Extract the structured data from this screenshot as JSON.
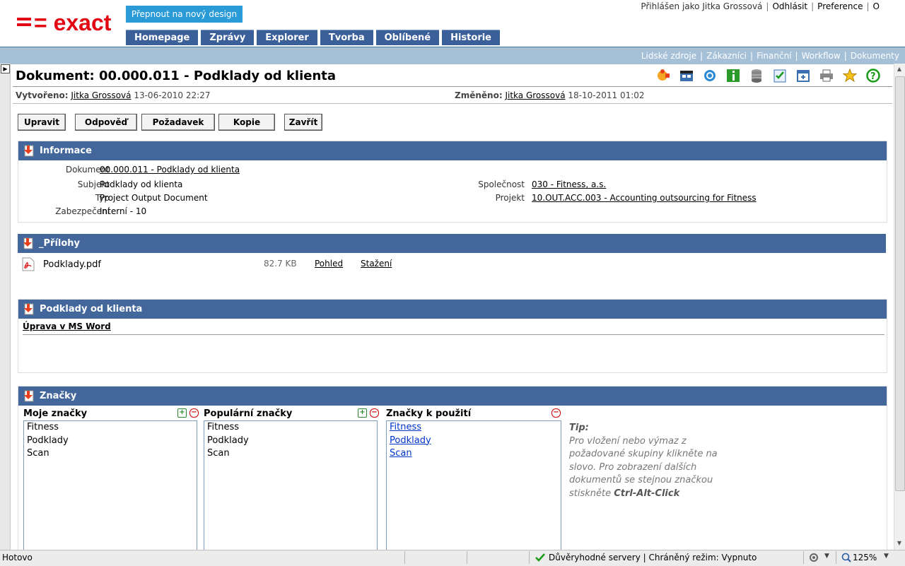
{
  "header": {
    "logo_text": "= exact",
    "new_design_button": "Přepnout na nový design",
    "nav": [
      "Homepage",
      "Zprávy",
      "Explorer",
      "Tvorba",
      "Oblíbené",
      "Historie"
    ],
    "user_links": [
      "Přihlášen jako Jitka Grossová",
      "Odhlásit",
      "Preference",
      "O"
    ],
    "sub_links": [
      "Lidské zdroje",
      "Zákazníci",
      "Finanční",
      "Workflow",
      "Dokumenty"
    ]
  },
  "document": {
    "title": "Dokument: 00.000.011 - Podklady od klienta",
    "created_label": "Vytvořeno:",
    "created_by": "Jitka Grossová",
    "created_at": "13-06-2010 22:27",
    "changed_label": "Změněno:",
    "changed_by": "Jitka Grossová",
    "changed_at": "18-10-2011 01:02"
  },
  "toolbar_icons": [
    "puzzle-icon",
    "clapboard-icon",
    "refresh-globe-icon",
    "info-icon",
    "database-icon",
    "checklist-icon",
    "add-window-icon",
    "print-icon",
    "favorite-star-icon",
    "help-icon"
  ],
  "actions": [
    "Upravit",
    "Odpověď",
    "Požadavek",
    "Kopie",
    "Zavřít"
  ],
  "info_panel": {
    "title": "Informace",
    "dokument_label": "Dokument",
    "dokument_value": "00.000.011 - Podklady od klienta",
    "subjekt_label": "Subjekt",
    "subjekt_value": "Podklady od klienta",
    "typ_label": "Typ",
    "typ_value": "Project Output Document",
    "zabezpeceni_label": "Zabezpečení",
    "zabezpeceni_value": "Interní - 10",
    "spolecnost_label": "Společnost",
    "spolecnost_value": "030 - Fitness, a.s.",
    "projekt_label": "Projekt",
    "projekt_value": "10.OUT.ACC.003 - Accounting outsourcing for Fitness"
  },
  "attachments_panel": {
    "title": "_Přílohy",
    "file_name": "Podklady.pdf",
    "file_size": "82.7 KB",
    "view_link": "Pohled",
    "download_link": "Stažení"
  },
  "content_panel": {
    "title": "Podklady od klienta",
    "edit_link": "Úprava v MS Word"
  },
  "tags_panel": {
    "title": "Značky",
    "my_tags_title": "Moje značky",
    "my_tags": [
      "Fitness",
      "Podklady",
      "Scan"
    ],
    "popular_tags_title": "Populární značky",
    "popular_tags": [
      "Fitness",
      "Podklady",
      "Scan"
    ],
    "used_tags_title": "Značky k použití",
    "used_tags": [
      "Fitness",
      "Podklady",
      "Scan"
    ],
    "tip_title": "Tip:",
    "tip_text": "Pro vložení nebo výmaz z požadované skupiny klikněte na slovo. Pro zobrazení dalších dokumentů se stejnou značkou stiskněte",
    "tip_shortcut": "Ctrl-Alt-Click"
  },
  "statusbar": {
    "status": "Hotovo",
    "trusted": "Důvěryhodné servery | Chráněný režim: Vypnuto",
    "zoom": "125%"
  }
}
